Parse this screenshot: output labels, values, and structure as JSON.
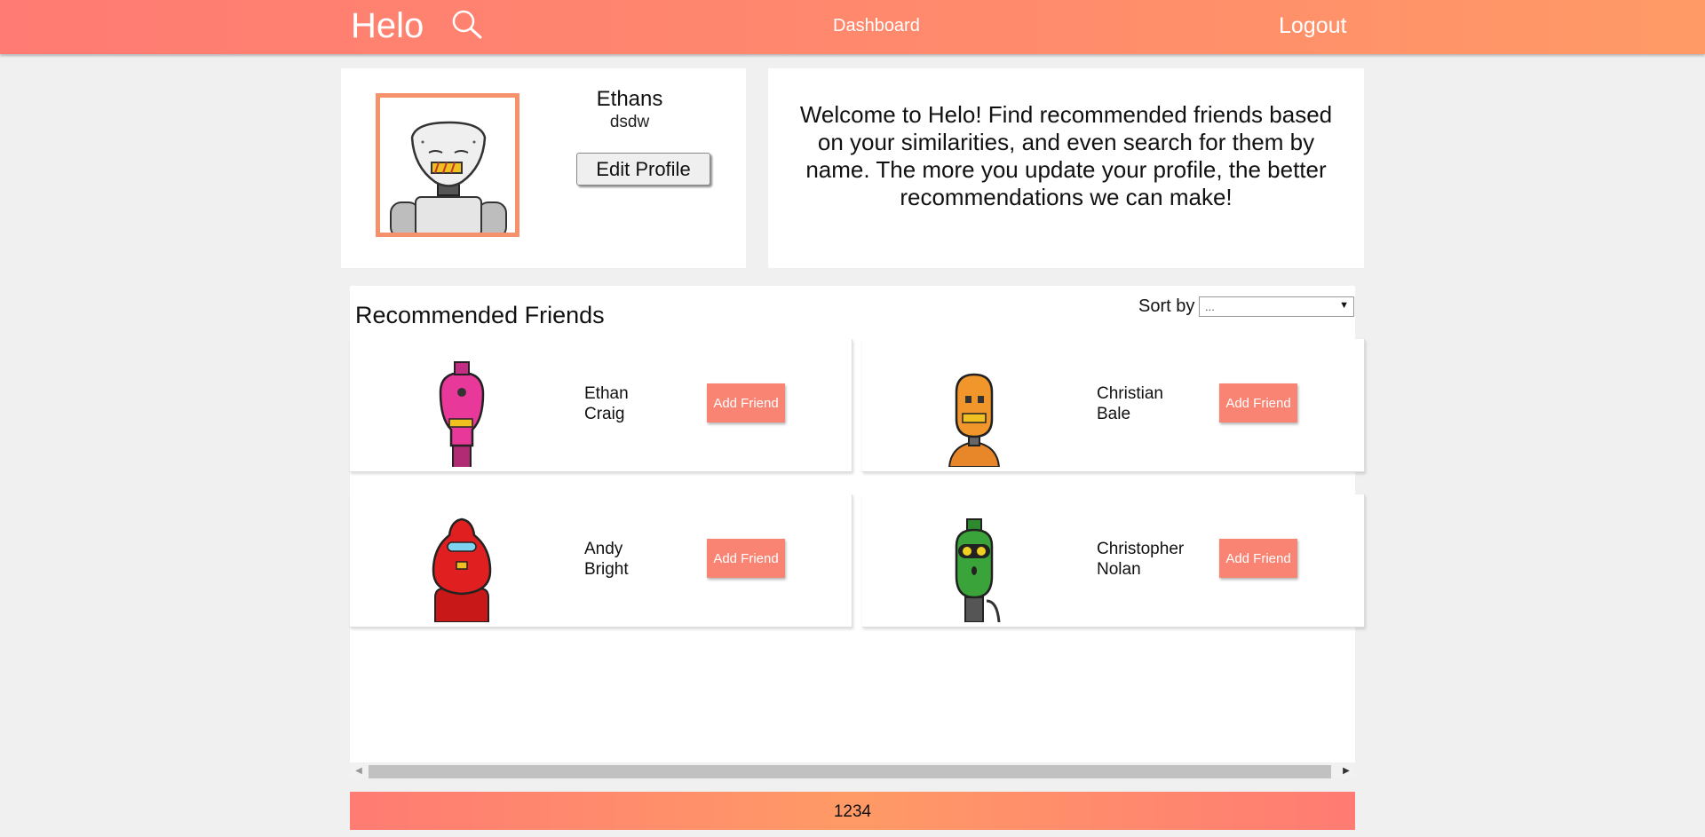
{
  "header": {
    "brand": "Helo",
    "search_icon": "search-icon",
    "nav_dashboard": "Dashboard",
    "nav_logout": "Logout"
  },
  "profile": {
    "name": "Ethans",
    "username": "dsdw",
    "edit_label": "Edit Profile",
    "avatar_icon": "robot-avatar-white"
  },
  "welcome": {
    "text": "Welcome to Helo! Find recommended friends based on your similarities, and even search for them by name. The more you update your profile, the better recommendations we can make!"
  },
  "recommended": {
    "title": "Recommended Friends",
    "sort_label": "Sort by",
    "sort_value": "...",
    "friends": [
      {
        "first": "Ethan",
        "last": "Craig",
        "button": "Add Friend",
        "avatar": "robot-avatar-pink",
        "color": "#e8399a"
      },
      {
        "first": "Christian",
        "last": "Bale",
        "button": "Add Friend",
        "avatar": "robot-avatar-orange",
        "color": "#f0962a"
      },
      {
        "first": "Andy",
        "last": "Bright",
        "button": "Add Friend",
        "avatar": "robot-avatar-red",
        "color": "#e02020"
      },
      {
        "first": "Christopher",
        "last": "Nolan",
        "button": "Add Friend",
        "avatar": "robot-avatar-green",
        "color": "#3aa43a"
      }
    ]
  },
  "footer": {
    "text": "1234"
  },
  "colors": {
    "accent": "#ff8570",
    "button": "#fa8473",
    "avatar_border": "#f5926b"
  }
}
